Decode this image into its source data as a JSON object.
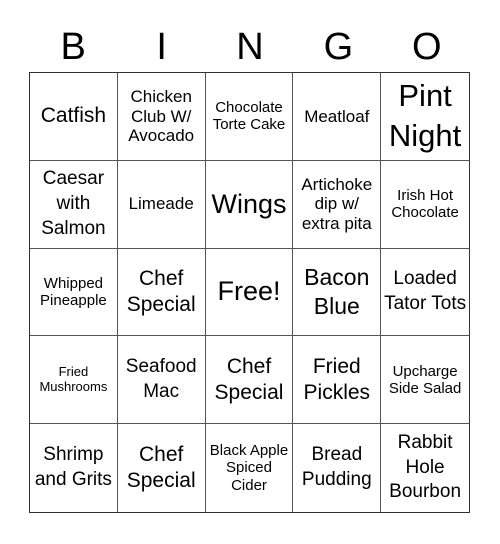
{
  "header": {
    "letters": [
      "B",
      "I",
      "N",
      "G",
      "O"
    ]
  },
  "cells": [
    "Catfish",
    "Chicken Club W/ Avocado",
    "Chocolate Torte Cake",
    "Meatloaf",
    "Pint Night",
    "Caesar with Salmon",
    "Limeade",
    "Wings",
    "Artichoke dip w/ extra pita",
    "Irish Hot Chocolate",
    "Whipped Pineapple",
    "Chef Special",
    "Free!",
    "Bacon Blue",
    "Loaded Tator Tots",
    "Fried Mushrooms",
    "Seafood Mac",
    "Chef Special",
    "Fried Pickles",
    "Upcharge Side Salad",
    "Shrimp and Grits",
    "Chef Special",
    "Black Apple Spiced Cider",
    "Bread Pudding",
    "Rabbit Hole Bourbon"
  ]
}
